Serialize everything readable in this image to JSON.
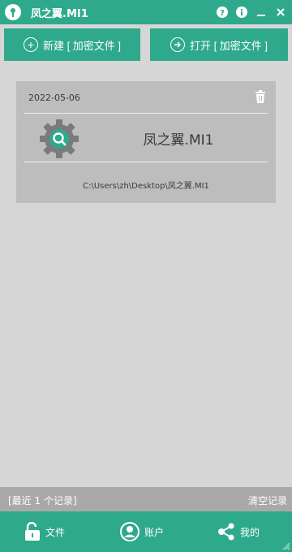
{
  "window": {
    "title": "凤之翼.MI1"
  },
  "actions": {
    "new_label": "新建 [ 加密文件 ]",
    "open_label": "打开 [ 加密文件 ]"
  },
  "record": {
    "date": "2022-05-06",
    "name": "凤之翼.MI1",
    "path": "C:\\Users\\zh\\Desktop\\凤之翼.MI1",
    "icon": "gear-search-icon"
  },
  "status": {
    "recent_label": "[最近 1 个记录]",
    "clear_label": "清空记录"
  },
  "nav": {
    "items": [
      {
        "label": "文件",
        "icon": "unlock-icon"
      },
      {
        "label": "账户",
        "icon": "user-icon"
      },
      {
        "label": "我的",
        "icon": "share-icon"
      }
    ]
  },
  "colors": {
    "accent": "#2fa98c",
    "background": "#d6d6d6",
    "card": "#bdbdbd",
    "status_bar": "#a9a9a9"
  }
}
